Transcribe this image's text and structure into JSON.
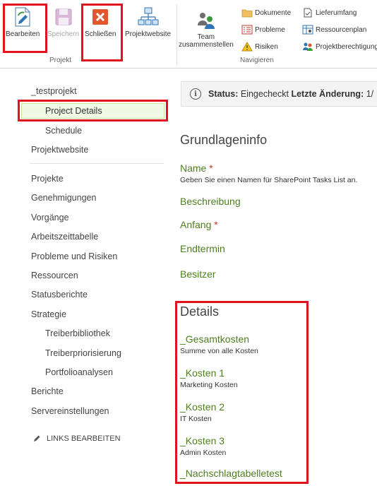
{
  "ribbon": {
    "edit_label": "Bearbeiten",
    "save_label": "Speichern",
    "close_label": "Schließen",
    "project_site_label": "Projektwebsite",
    "team_label_line1": "Team",
    "team_label_line2": "zusammenstellen",
    "documents_label": "Dokumente",
    "issues_label": "Probleme",
    "risks_label": "Risiken",
    "deliverables_label": "Lieferumfang",
    "resource_plan_label": "Ressourcenplan",
    "permissions_label": "Projektberechtigung",
    "group_project": "Projekt",
    "group_navigate": "Navigieren"
  },
  "nav": {
    "project_name": "_testprojekt",
    "project_details": "Project Details",
    "schedule": "Schedule",
    "project_site": "Projektwebsite",
    "projects": "Projekte",
    "approvals": "Genehmigungen",
    "tasks": "Vorgänge",
    "timesheet": "Arbeitszeittabelle",
    "issues_risks": "Probleme und Risiken",
    "resources": "Ressourcen",
    "status_reports": "Statusberichte",
    "strategy": "Strategie",
    "driver_library": "Treiberbibliothek",
    "driver_prioritization": "Treiberpriorisierung",
    "portfolio_analyses": "Portfolioanalysen",
    "reports": "Berichte",
    "server_settings": "Servereinstellungen",
    "edit_links": "LINKS BEARBEITEN"
  },
  "status": {
    "status_label": "Status:",
    "status_value": "Eingecheckt",
    "last_change_label": "Letzte Änderung:",
    "last_change_value": "1/"
  },
  "basic_info": {
    "title": "Grundlageninfo",
    "name_label": "Name",
    "required_mark": "*",
    "name_desc": "Geben Sie einen Namen für SharePoint Tasks List an.",
    "description_label": "Beschreibung",
    "start_label": "Anfang",
    "end_label": "Endtermin",
    "owner_label": "Besitzer"
  },
  "details": {
    "title": "Details",
    "total_costs_label": "_Gesamtkosten",
    "total_costs_desc": "Summe von alle Kosten",
    "cost1_label": "_Kosten 1",
    "cost1_desc": "Marketing Kosten",
    "cost2_label": "_Kosten 2",
    "cost2_desc": "IT Kosten",
    "cost3_label": "_Kosten 3",
    "cost3_desc": "Admin Kosten",
    "lookup_label": "_Nachschlagtabelletest"
  }
}
